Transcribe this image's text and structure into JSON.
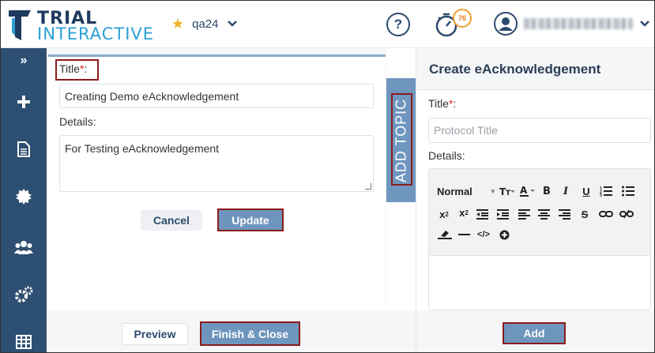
{
  "brand": {
    "line1": "TRIAL",
    "line2": "INTERACTIVE"
  },
  "header": {
    "study_name": "qa24",
    "help_label": "?",
    "timer_count": "76"
  },
  "form": {
    "title_label": "Title",
    "required_mark": "*",
    "colon": ":",
    "title_value": "Creating Demo eAcknowledgement",
    "details_label": "Details:",
    "details_value": "For Testing eAcknowledgement",
    "cancel_label": "Cancel",
    "update_label": "Update"
  },
  "add_topic_label": "ADD TOPIC",
  "right_panel": {
    "title": "Create eAcknowledgement",
    "title_label": "Title",
    "required_mark": "*",
    "colon": ":",
    "title_placeholder": "Protocol Title",
    "details_label": "Details:",
    "toolbar": {
      "format_label": "Normal"
    },
    "add_label": "Add"
  },
  "footer": {
    "preview_label": "Preview",
    "finish_label": "Finish & Close"
  },
  "colors": {
    "sidebar": "#2d4f72",
    "accent_blue": "#6e95bd",
    "callout_red": "#8b1c1c",
    "star": "#f0b323",
    "timer_badge": "#f0a030"
  },
  "icons": {
    "sidebar": [
      "expand-icon",
      "plus-icon",
      "document-icon",
      "gear-badge-icon",
      "users-icon",
      "cogs-icon",
      "grid-icon"
    ]
  }
}
